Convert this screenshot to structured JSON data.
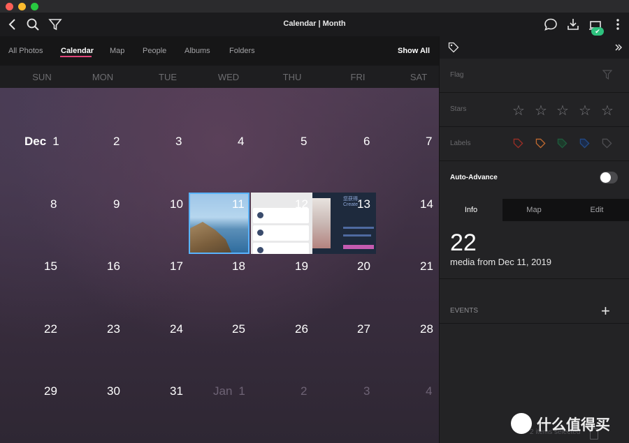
{
  "window": {
    "title": "Calendar | Month"
  },
  "toolbar": {
    "badge": "✔"
  },
  "nav": {
    "items": [
      {
        "label": "All Photos",
        "active": false
      },
      {
        "label": "Calendar",
        "active": true
      },
      {
        "label": "Map",
        "active": false
      },
      {
        "label": "People",
        "active": false
      },
      {
        "label": "Albums",
        "active": false
      },
      {
        "label": "Folders",
        "active": false
      }
    ],
    "show_all": "Show All"
  },
  "calendar": {
    "weekdays": [
      "SUN",
      "MON",
      "TUE",
      "WED",
      "THU",
      "FRI",
      "SAT"
    ],
    "month_label": "Dec",
    "next_month_label": "Jan",
    "weeks": [
      [
        "1",
        "2",
        "3",
        "4",
        "5",
        "6",
        "7"
      ],
      [
        "8",
        "9",
        "10",
        "11",
        "12",
        "13",
        "14"
      ],
      [
        "15",
        "16",
        "17",
        "18",
        "19",
        "20",
        "21"
      ],
      [
        "22",
        "23",
        "24",
        "25",
        "26",
        "27",
        "28"
      ],
      [
        "29",
        "30",
        "31",
        "1",
        "2",
        "3",
        "4"
      ]
    ]
  },
  "thumbnails": {
    "t3_heading_cn": "您获得...",
    "t3_heading_en": "Create"
  },
  "panel": {
    "flag_label": "Flag",
    "stars_label": "Stars",
    "labels_label": "Labels",
    "auto_advance_label": "Auto-Advance",
    "auto_advance_on": false,
    "tabs": [
      "Info",
      "Map",
      "Edit"
    ],
    "active_tab": "Info",
    "media_count": "22",
    "media_desc": "media from Dec 11, 2019",
    "events_label": "EVENTS",
    "label_colors": [
      "#c0392b",
      "#d9793b",
      "#1f8a4c",
      "#2c5fa8",
      "#555559"
    ]
  },
  "status": {
    "selection_text": "2 items selected"
  },
  "watermark": {
    "text": "什么值得买"
  }
}
